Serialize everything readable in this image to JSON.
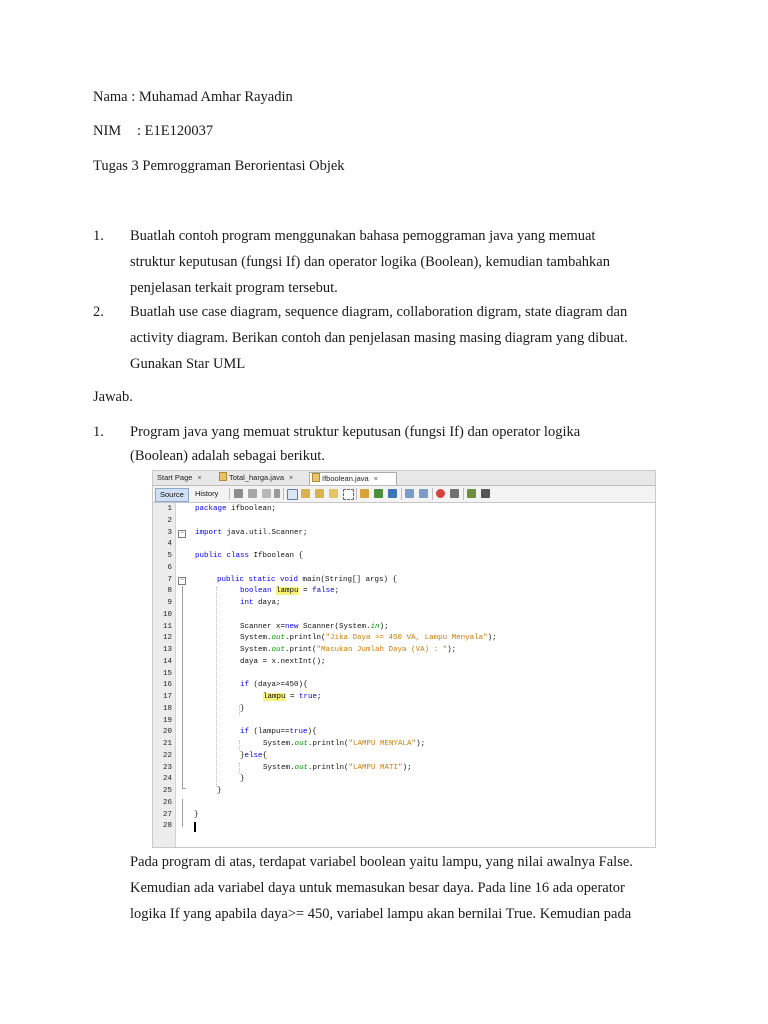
{
  "header": {
    "nama": "Nama : Muhamad Amhar Rayadin",
    "nim_label": "NIM",
    "nim_value": ": E1E120037",
    "tugas": "Tugas 3 Pemroggraman Berorientasi Objek"
  },
  "questions": [
    {
      "num": "1.",
      "lines": [
        "Buatlah contoh program menggunakan bahasa pemoggraman java yang memuat",
        "struktur keputusan (fungsi If) dan operator logika (Boolean), kemudian tambahkan",
        "penjelasan terkait program tersebut."
      ]
    },
    {
      "num": "2.",
      "lines": [
        "Buatlah use case diagram, sequence diagram, collaboration digram, state diagram dan",
        "activity diagram. Berikan contoh dan penjelasan masing masing diagram yang dibuat.",
        "Gunakan Star UML"
      ]
    }
  ],
  "jawab": "Jawab.",
  "answer1": {
    "num": "1.",
    "lines": [
      "Program java yang memuat struktur keputusan (fungsi If) dan operator logika",
      "(Boolean) adalah sebagai berikut."
    ]
  },
  "ide": {
    "tabs": [
      "Start Page",
      "Total_harga.java",
      "Ifboolean.java"
    ],
    "close_glyph": "×",
    "toolbar": {
      "source": "Source",
      "history": "History"
    },
    "line_numbers": [
      "1",
      "2",
      "3",
      "4",
      "5",
      "6",
      "7",
      "8",
      "9",
      "10",
      "11",
      "12",
      "13",
      "14",
      "15",
      "16",
      "17",
      "18",
      "19",
      "20",
      "21",
      "22",
      "23",
      "24",
      "25",
      "26",
      "27",
      "28"
    ],
    "code": {
      "l1_kw": "package",
      "l1_rest": " ifboolean;",
      "l3_kw": "import",
      "l3_rest": " java.util.Scanner;",
      "l5_kw": "public class",
      "l5_rest": " Ifboolean {",
      "l7_kw": "public static void",
      "l7_rest": " main(String[] args) {",
      "l8_kw": "boolean",
      "l8_var": "lampu",
      "l8_mid": " = ",
      "l8_kw2": "false",
      "l8_end": ";",
      "l9_kw": "int",
      "l9_rest": " daya;",
      "l11_a": "Scanner x=",
      "l11_kw": "new",
      "l11_b": " Scanner(System.",
      "l11_fld": "in",
      "l11_c": ");",
      "l12_a": "System.",
      "l12_fld": "out",
      "l12_b": ".println(",
      "l12_str": "\"Jika Daya >= 450 VA, Lampu Menyala\"",
      "l12_c": ");",
      "l13_a": "System.",
      "l13_fld": "out",
      "l13_b": ".print(",
      "l13_str": "\"Masukan Jumlah Daya (VA) : \"",
      "l13_c": ");",
      "l14": "daya = x.nextInt();",
      "l16_kw": "if",
      "l16_rest": " (daya>=450){",
      "l17_var": "lampu",
      "l17_mid": " = ",
      "l17_kw": "true",
      "l17_end": ";",
      "l18": "}",
      "l20_kw": "if",
      "l20_a": " (lampu==",
      "l20_kw2": "true",
      "l20_b": "){",
      "l21_a": "System.",
      "l21_fld": "out",
      "l21_b": ".println(",
      "l21_str": "\"LAMPU MENYALA\"",
      "l21_c": ");",
      "l22_a": "}",
      "l22_kw": "else",
      "l22_b": "{",
      "l23_a": "System.",
      "l23_fld": "out",
      "l23_b": ".println(",
      "l23_str": "\"LAMPU MATI\"",
      "l23_c": ");",
      "l24": "}",
      "l25": "}",
      "l27": "}"
    }
  },
  "explanation": [
    "Pada program di atas, terdapat variabel boolean yaitu lampu, yang nilai awalnya False.",
    "Kemudian ada variabel daya untuk memasukan besar daya. Pada line 16 ada operator",
    "logika If yang apabila daya>= 450, variabel lampu akan bernilai True. Kemudian pada"
  ]
}
